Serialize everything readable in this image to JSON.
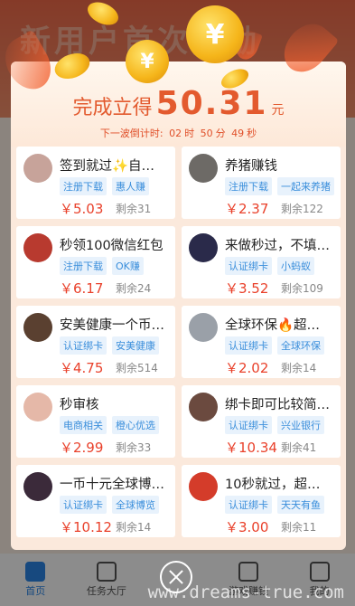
{
  "background": {
    "title": "新用户首次奖励"
  },
  "modal": {
    "headline_prefix": "完成立得",
    "amount": "50.31",
    "unit": "元",
    "countdown_label": "下一波倒计时:",
    "countdown_h": "02",
    "countdown_h_unit": "时",
    "countdown_m": "50",
    "countdown_m_unit": "分",
    "countdown_s": "49",
    "countdown_s_unit": "秒"
  },
  "tasks": [
    {
      "title": "签到就过✨自…",
      "tags": [
        "注册下载",
        "惠人赚"
      ],
      "price": "￥5.03",
      "remain": "剩余31",
      "avatar_color": "#c7a39a"
    },
    {
      "title": "养猪赚钱",
      "tags": [
        "注册下载",
        "一起来养猪"
      ],
      "price": "￥2.37",
      "remain": "剩余122",
      "avatar_color": "#6d6a66"
    },
    {
      "title": "秒领100微信红包",
      "tags": [
        "注册下载",
        "OK赚"
      ],
      "price": "￥6.17",
      "remain": "剩余24",
      "avatar_color": "#b83a2f"
    },
    {
      "title": "来做秒过，不填…",
      "tags": [
        "认证绑卡",
        "小蚂蚁"
      ],
      "price": "￥3.52",
      "remain": "剩余109",
      "avatar_color": "#2a2a4a"
    },
    {
      "title": "安美健康一个币…",
      "tags": [
        "认证绑卡",
        "安美健康"
      ],
      "price": "￥4.75",
      "remain": "剩余514",
      "avatar_color": "#5a4030"
    },
    {
      "title": "全球环保🔥超…",
      "tags": [
        "认证绑卡",
        "全球环保"
      ],
      "price": "￥2.02",
      "remain": "剩余14",
      "avatar_color": "#9aa0a8"
    },
    {
      "title": "秒审核",
      "tags": [
        "电商相关",
        "橙心优选"
      ],
      "price": "￥2.99",
      "remain": "剩余33",
      "avatar_color": "#e5b8a8"
    },
    {
      "title": "绑卡即可比较简…",
      "tags": [
        "认证绑卡",
        "兴业银行"
      ],
      "price": "￥10.34",
      "remain": "剩余41",
      "avatar_color": "#6b4a3f"
    },
    {
      "title": "一币十元全球博…",
      "tags": [
        "认证绑卡",
        "全球博览"
      ],
      "price": "￥10.12",
      "remain": "剩余14",
      "avatar_color": "#3b2a3a"
    },
    {
      "title": "10秒就过，超…",
      "tags": [
        "认证绑卡",
        "天天有鱼"
      ],
      "price": "￥3.00",
      "remain": "剩余11",
      "avatar_color": "#d43c2a"
    }
  ],
  "nav": [
    "首页",
    "任务大厅",
    "",
    "游戏赚钱",
    "我的"
  ],
  "watermark": "www.dreams-true.com",
  "coin_symbol": "¥",
  "colors": {
    "accent": "#e35a2e",
    "price": "#e9412b",
    "tag_text": "#3a8edb",
    "active_nav": "#2b86e8"
  }
}
